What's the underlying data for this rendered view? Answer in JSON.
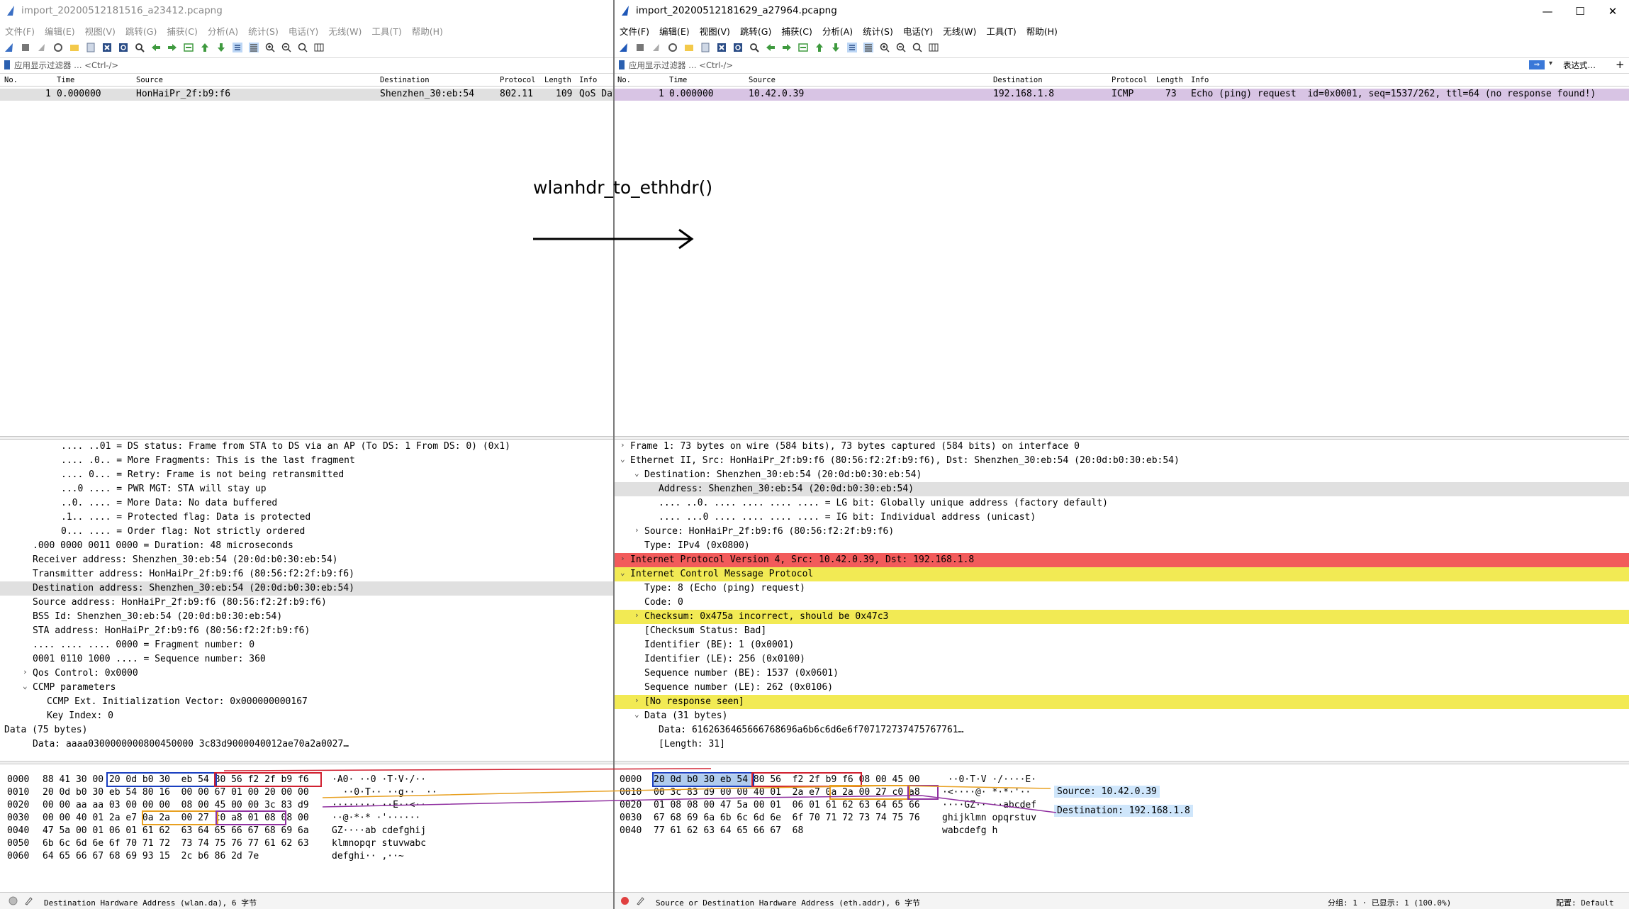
{
  "left": {
    "title": "import_20200512181516_a23412.pcapng",
    "menu": [
      "文件(F)",
      "编辑(E)",
      "视图(V)",
      "跳转(G)",
      "捕获(C)",
      "分析(A)",
      "统计(S)",
      "电话(Y)",
      "无线(W)",
      "工具(T)",
      "帮助(H)"
    ],
    "filter_placeholder": "应用显示过滤器 … <Ctrl-/>",
    "columns": [
      "No.",
      "Time",
      "Source",
      "Destination",
      "Protocol",
      "Length",
      "Info"
    ],
    "packet": {
      "no": "1",
      "time": "0.000000",
      "source": "HonHaiPr_2f:b9:f6",
      "destination": "Shenzhen_30:eb:54",
      "protocol": "802.11",
      "length": "109",
      "info": "QoS Da"
    },
    "details": [
      {
        "indent": 4,
        "toggle": "",
        "text": ".... ..01 = DS status: Frame from STA to DS via an AP (To DS: 1 From DS: 0) (0x1)"
      },
      {
        "indent": 4,
        "toggle": "",
        "text": ".... .0.. = More Fragments: This is the last fragment"
      },
      {
        "indent": 4,
        "toggle": "",
        "text": ".... 0... = Retry: Frame is not being retransmitted"
      },
      {
        "indent": 4,
        "toggle": "",
        "text": "...0 .... = PWR MGT: STA will stay up"
      },
      {
        "indent": 4,
        "toggle": "",
        "text": "..0. .... = More Data: No data buffered"
      },
      {
        "indent": 4,
        "toggle": "",
        "text": ".1.. .... = Protected flag: Data is protected"
      },
      {
        "indent": 4,
        "toggle": "",
        "text": "0... .... = Order flag: Not strictly ordered"
      },
      {
        "indent": 2,
        "toggle": "",
        "text": ".000 0000 0011 0000 = Duration: 48 microseconds"
      },
      {
        "indent": 2,
        "toggle": "",
        "text": "Receiver address: Shenzhen_30:eb:54 (20:0d:b0:30:eb:54)"
      },
      {
        "indent": 2,
        "toggle": "",
        "text": "Transmitter address: HonHaiPr_2f:b9:f6 (80:56:f2:2f:b9:f6)"
      },
      {
        "indent": 2,
        "toggle": "",
        "text": "Destination address: Shenzhen_30:eb:54 (20:0d:b0:30:eb:54)",
        "hl": "sel"
      },
      {
        "indent": 2,
        "toggle": "",
        "text": "Source address: HonHaiPr_2f:b9:f6 (80:56:f2:2f:b9:f6)"
      },
      {
        "indent": 2,
        "toggle": "",
        "text": "BSS Id: Shenzhen_30:eb:54 (20:0d:b0:30:eb:54)"
      },
      {
        "indent": 2,
        "toggle": "",
        "text": "STA address: HonHaiPr_2f:b9:f6 (80:56:f2:2f:b9:f6)"
      },
      {
        "indent": 2,
        "toggle": "",
        "text": ".... .... .... 0000 = Fragment number: 0"
      },
      {
        "indent": 2,
        "toggle": "",
        "text": "0001 0110 1000 .... = Sequence number: 360"
      },
      {
        "indent": 2,
        "toggle": "›",
        "text": "Qos Control: 0x0000"
      },
      {
        "indent": 2,
        "toggle": "⌄",
        "text": "CCMP parameters"
      },
      {
        "indent": 3,
        "toggle": "",
        "text": "CCMP Ext. Initialization Vector: 0x000000000167"
      },
      {
        "indent": 3,
        "toggle": "",
        "text": "Key Index: 0"
      },
      {
        "indent": 0,
        "toggle": "⌄",
        "text": "Data (75 bytes)"
      },
      {
        "indent": 2,
        "toggle": "",
        "text": "Data: aaaa0300000000800450000 3c83d9000040012ae70a2a0027…"
      }
    ],
    "hex_offsets": [
      "0000",
      "0010",
      "0020",
      "0030",
      "0040",
      "0050",
      "0060"
    ],
    "hex_bytes": [
      "88 41 30 00 20 0d b0 30  eb 54 80 56 f2 2f b9 f6",
      "20 0d b0 30 eb 54 80 16  00 00 67 01 00 20 00 00",
      "00 00 aa aa 03 00 00 00  08 00 45 00 00 3c 83 d9",
      "00 00 40 01 2a e7 0a 2a  00 27 c0 a8 01 08 08 00",
      "47 5a 00 01 06 01 61 62  63 64 65 66 67 68 69 6a",
      "6b 6c 6d 6e 6f 70 71 72  73 74 75 76 77 61 62 63",
      "64 65 66 67 68 69 93 15  2c b6 86 2d 7e"
    ],
    "hex_ascii": [
      "·A0· ··0 ·T·V·/··",
      "  ··0·T·· ··g··  ··",
      "········ ··E··<··",
      "··@·*·* ·'······",
      "GZ····ab cdefghij",
      "klmnopqr stuvwabc",
      "defghi·· ,··~"
    ],
    "status": "Destination Hardware Address (wlan.da), 6 字节"
  },
  "right": {
    "title": "import_20200512181629_a27964.pcapng",
    "menu": [
      "文件(F)",
      "编辑(E)",
      "视图(V)",
      "跳转(G)",
      "捕获(C)",
      "分析(A)",
      "统计(S)",
      "电话(Y)",
      "无线(W)",
      "工具(T)",
      "帮助(H)"
    ],
    "filter_placeholder": "应用显示过滤器 … <Ctrl-/>",
    "expression": "表达式…",
    "columns": [
      "No.",
      "Time",
      "Source",
      "Destination",
      "Protocol",
      "Length",
      "Info"
    ],
    "packet": {
      "no": "1",
      "time": "0.000000",
      "source": "10.42.0.39",
      "destination": "192.168.1.8",
      "protocol": "ICMP",
      "length": "73",
      "info": "Echo (ping) request  id=0x0001, seq=1537/262, ttl=64 (no response found!)"
    },
    "details": [
      {
        "indent": 0,
        "toggle": "›",
        "text": "Frame 1: 73 bytes on wire (584 bits), 73 bytes captured (584 bits) on interface 0"
      },
      {
        "indent": 0,
        "toggle": "⌄",
        "text": "Ethernet II, Src: HonHaiPr_2f:b9:f6 (80:56:f2:2f:b9:f6), Dst: Shenzhen_30:eb:54 (20:0d:b0:30:eb:54)"
      },
      {
        "indent": 1,
        "toggle": "⌄",
        "text": "Destination: Shenzhen_30:eb:54 (20:0d:b0:30:eb:54)"
      },
      {
        "indent": 2,
        "toggle": "",
        "text": "Address: Shenzhen_30:eb:54 (20:0d:b0:30:eb:54)",
        "hl": "sel"
      },
      {
        "indent": 2,
        "toggle": "",
        "text": ".... ..0. .... .... .... .... = LG bit: Globally unique address (factory default)"
      },
      {
        "indent": 2,
        "toggle": "",
        "text": ".... ...0 .... .... .... .... = IG bit: Individual address (unicast)"
      },
      {
        "indent": 1,
        "toggle": "›",
        "text": "Source: HonHaiPr_2f:b9:f6 (80:56:f2:2f:b9:f6)"
      },
      {
        "indent": 1,
        "toggle": "",
        "text": "Type: IPv4 (0x0800)"
      },
      {
        "indent": 0,
        "toggle": "›",
        "text": "Internet Protocol Version 4, Src: 10.42.0.39, Dst: 192.168.1.8",
        "hl": "red"
      },
      {
        "indent": 0,
        "toggle": "⌄",
        "text": "Internet Control Message Protocol",
        "hl": "yellow"
      },
      {
        "indent": 1,
        "toggle": "",
        "text": "Type: 8 (Echo (ping) request)"
      },
      {
        "indent": 1,
        "toggle": "",
        "text": "Code: 0"
      },
      {
        "indent": 1,
        "toggle": "›",
        "text": "Checksum: 0x475a incorrect, should be 0x47c3",
        "hl": "yellow"
      },
      {
        "indent": 1,
        "toggle": "",
        "text": "[Checksum Status: Bad]"
      },
      {
        "indent": 1,
        "toggle": "",
        "text": "Identifier (BE): 1 (0x0001)"
      },
      {
        "indent": 1,
        "toggle": "",
        "text": "Identifier (LE): 256 (0x0100)"
      },
      {
        "indent": 1,
        "toggle": "",
        "text": "Sequence number (BE): 1537 (0x0601)"
      },
      {
        "indent": 1,
        "toggle": "",
        "text": "Sequence number (LE): 262 (0x0106)"
      },
      {
        "indent": 1,
        "toggle": "›",
        "text": "[No response seen]",
        "hl": "yellow"
      },
      {
        "indent": 1,
        "toggle": "⌄",
        "text": "Data (31 bytes)"
      },
      {
        "indent": 2,
        "toggle": "",
        "text": "Data: 6162636465666768696a6b6c6d6e6f707172737475767761…"
      },
      {
        "indent": 2,
        "toggle": "",
        "text": "[Length: 31]"
      }
    ],
    "hex_offsets": [
      "0000",
      "0010",
      "0020",
      "0030",
      "0040"
    ],
    "hex_bytes": [
      "20 0d b0 30 eb 54 80 56  f2 2f b9 f6 08 00 45 00",
      "00 3c 83 d9 00 00 40 01  2a e7 0a 2a 00 27 c0 a8",
      "01 08 08 00 47 5a 00 01  06 01 61 62 63 64 65 66",
      "67 68 69 6a 6b 6c 6d 6e  6f 70 71 72 73 74 75 76",
      "77 61 62 63 64 65 66 67  68"
    ],
    "hex_ascii": [
      " ··0·T·V ·/····E·",
      "·<····@· *·*·'··",
      "····GZ·· ··abcdef",
      "ghijklmn opqrstuv",
      "wabcdefg h"
    ],
    "tooltip_source": "Source: 10.42.0.39",
    "tooltip_destination": "Destination: 192.168.1.8",
    "status_left": "Source or Destination Hardware Address (eth.addr), 6 字节",
    "status_packets": "分组: 1 · 已显示: 1 (100.0%)",
    "status_profile": "配置: Default"
  },
  "annotation": {
    "label": "wlanhdr_to_ethhdr()"
  },
  "colors": {
    "selected": "#e0e0e0",
    "icmp_row": "#d8c4e4",
    "ip_red": "#f25b5b",
    "icmp_yellow": "#f2ea54",
    "hex_sel": "#1e6ecf"
  }
}
